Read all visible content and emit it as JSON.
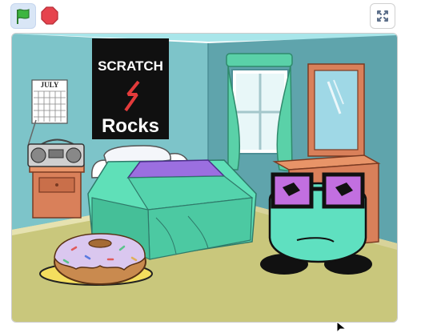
{
  "toolbar": {
    "green_flag": {
      "icon": "green-flag-icon",
      "color": "#3db53f",
      "active": true
    },
    "stop": {
      "icon": "stop-icon",
      "color": "#e6434d"
    },
    "fullscreen": {
      "icon": "fullscreen-icon"
    }
  },
  "stage": {
    "backdrop": "bedroom",
    "poster": {
      "line1": "SCRATCH",
      "line2": "Rocks"
    },
    "calendar": {
      "month": "JULY"
    },
    "sprites": [
      "boombox",
      "nightstand",
      "bed",
      "window",
      "dresser",
      "mirror",
      "donut",
      "glasses-character"
    ]
  },
  "colors": {
    "wall": "#7dc4c9",
    "wall_side": "#5fa4ac",
    "floor": "#c9c77c",
    "bedspread": "#5fe0b8",
    "blanket": "#9b6fe0",
    "curtain": "#5ad1a8",
    "character": "#5fe0c0",
    "glasses": "#c26fe0"
  }
}
